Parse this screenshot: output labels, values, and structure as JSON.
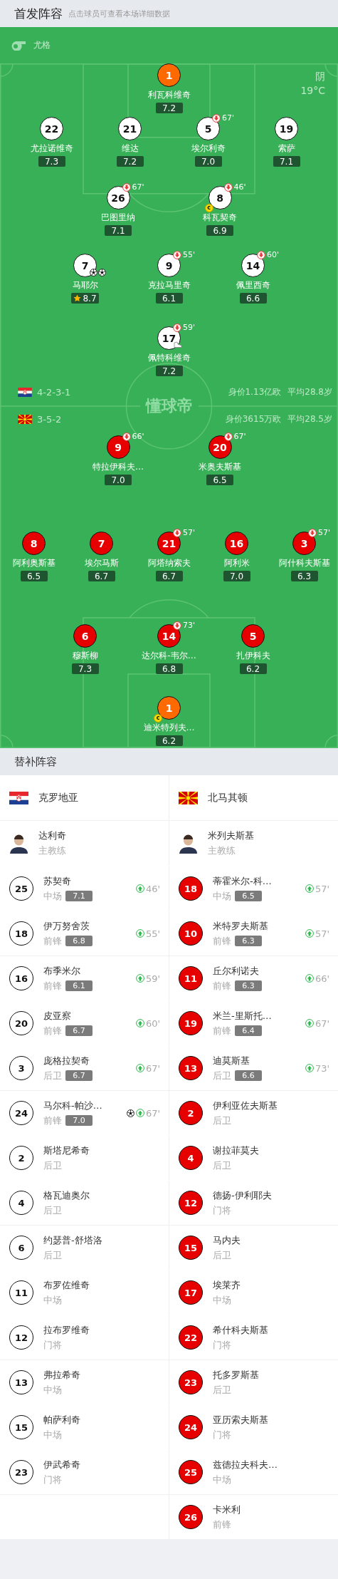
{
  "header": {
    "title": "首发阵容",
    "hint": "点击球员可查看本场详细数据"
  },
  "pitch": {
    "referee": "尤格",
    "weather": "阴",
    "temperature": "19°C",
    "logo": "懂球帝",
    "home": {
      "kind": "croatia",
      "color": "#ffffff",
      "formation": "4-2-3-1",
      "value": "身价1.13亿欧",
      "age": "平均28.8岁",
      "lines": [
        [
          {
            "number": "1",
            "name": "利瓦科维奇",
            "rating": "7.2",
            "kind": "keeper",
            "best": false
          }
        ],
        [
          {
            "number": "22",
            "name": "尤拉诺维奇",
            "rating": "7.3",
            "kind": "field",
            "best": false
          },
          {
            "number": "21",
            "name": "维达",
            "rating": "7.2",
            "kind": "field",
            "best": false
          },
          {
            "number": "5",
            "name": "埃尔利奇",
            "rating": "7.0",
            "kind": "field",
            "best": false,
            "sub_out": "67'"
          },
          {
            "number": "19",
            "name": "索萨",
            "rating": "7.1",
            "kind": "field",
            "best": false
          }
        ],
        [
          {
            "number": "26",
            "name": "巴图里纳",
            "rating": "7.1",
            "kind": "field",
            "best": false,
            "sub_out": "67'"
          },
          {
            "number": "8",
            "name": "科瓦契奇",
            "rating": "6.9",
            "kind": "field",
            "best": false,
            "sub_out": "46'",
            "captain": "c"
          }
        ],
        [
          {
            "number": "7",
            "name": "马耶尔",
            "rating": "8.7",
            "kind": "field",
            "best": true,
            "events": [
              {
                "kind": "goal"
              },
              {
                "kind": "goal"
              }
            ]
          },
          {
            "number": "9",
            "name": "克拉马里奇",
            "rating": "6.1",
            "kind": "field",
            "best": false,
            "sub_out": "55'"
          },
          {
            "number": "14",
            "name": "佩里西奇",
            "rating": "6.6",
            "kind": "field",
            "best": false,
            "sub_out": "60'"
          }
        ],
        [
          {
            "number": "17",
            "name": "佩特科维奇",
            "rating": "7.2",
            "kind": "field",
            "best": false,
            "sub_out": "59'",
            "events": [
              {
                "kind": "assist"
              }
            ]
          }
        ]
      ]
    },
    "away": {
      "kind": "macedonia",
      "color": "#e60000",
      "formation": "3-5-2",
      "value": "身价3615万欧",
      "age": "平均28.5岁",
      "lines": [
        [
          {
            "number": "9",
            "name": "特拉伊科夫…",
            "rating": "7.0",
            "kind": "field",
            "best": false,
            "sub_out": "66'"
          },
          {
            "number": "20",
            "name": "米奥夫斯基",
            "rating": "6.5",
            "kind": "field",
            "best": false,
            "sub_out": "67'"
          }
        ],
        [
          {
            "number": "8",
            "name": "阿利奥斯基",
            "rating": "6.5",
            "kind": "field",
            "best": false
          },
          {
            "number": "7",
            "name": "埃尔马斯",
            "rating": "6.7",
            "kind": "field",
            "best": false
          },
          {
            "number": "21",
            "name": "阿塔纳索夫",
            "rating": "6.7",
            "kind": "field",
            "best": false,
            "sub_out": "57'"
          },
          {
            "number": "16",
            "name": "阿利米",
            "rating": "7.0",
            "kind": "field",
            "best": false
          },
          {
            "number": "3",
            "name": "阿什科夫斯基",
            "rating": "6.3",
            "kind": "field",
            "best": false,
            "sub_out": "57'"
          }
        ],
        [
          {
            "number": "6",
            "name": "穆斯柳",
            "rating": "7.3",
            "kind": "field",
            "best": false
          },
          {
            "number": "14",
            "name": "达尔科-韦尔…",
            "rating": "6.8",
            "kind": "field",
            "best": false,
            "sub_out": "73'"
          },
          {
            "number": "5",
            "name": "扎伊科夫",
            "rating": "6.2",
            "kind": "field",
            "best": false
          }
        ],
        [
          {
            "number": "1",
            "name": "迪米特列夫…",
            "rating": "6.2",
            "kind": "keeper",
            "best": false,
            "captain": "c"
          }
        ]
      ]
    }
  },
  "substitutes": {
    "title": "替补阵容",
    "teams": [
      {
        "name": "克罗地亚",
        "kind": "croatia",
        "color": "#ffffff",
        "coach": {
          "name": "达利奇",
          "role": "主教练"
        },
        "players": [
          {
            "number": "25",
            "name": "苏契奇",
            "position": "中场",
            "rating": "7.1",
            "sub_in": "46'"
          },
          {
            "number": "18",
            "name": "伊万努舍茨",
            "position": "前锋",
            "rating": "6.8",
            "sub_in": "55'"
          },
          {
            "number": "16",
            "name": "布季米尔",
            "position": "前锋",
            "rating": "6.1",
            "sub_in": "59'"
          },
          {
            "number": "20",
            "name": "皮亚察",
            "position": "前锋",
            "rating": "6.7",
            "sub_in": "60'"
          },
          {
            "number": "3",
            "name": "庞格拉契奇",
            "position": "后卫",
            "rating": "6.7",
            "sub_in": "67'"
          },
          {
            "number": "24",
            "name": "马尔科-帕沙…",
            "position": "前锋",
            "rating": "7.0",
            "sub_in": "67'",
            "events": [
              {
                "kind": "goal"
              }
            ]
          },
          {
            "number": "2",
            "name": "斯塔尼希奇",
            "position": "后卫"
          },
          {
            "number": "4",
            "name": "格瓦迪奥尔",
            "position": "后卫"
          },
          {
            "number": "6",
            "name": "约瑟普-舒塔洛",
            "position": "后卫"
          },
          {
            "number": "11",
            "name": "布罗佐维奇",
            "position": "中场"
          },
          {
            "number": "12",
            "name": "拉布罗维奇",
            "position": "门将"
          },
          {
            "number": "13",
            "name": "弗拉希奇",
            "position": "中场"
          },
          {
            "number": "15",
            "name": "帕萨利奇",
            "position": "中场"
          },
          {
            "number": "23",
            "name": "伊武希奇",
            "position": "门将"
          }
        ]
      },
      {
        "name": "北马其顿",
        "kind": "macedonia",
        "color": "#e60000",
        "coach": {
          "name": "米列夫斯基",
          "role": "主教练"
        },
        "players": [
          {
            "number": "18",
            "name": "蒂霍米尔-科…",
            "position": "中场",
            "rating": "6.5",
            "sub_in": "57'"
          },
          {
            "number": "10",
            "name": "米特罗夫斯基",
            "position": "前锋",
            "rating": "6.3",
            "sub_in": "57'"
          },
          {
            "number": "11",
            "name": "丘尔利诺夫",
            "position": "前锋",
            "rating": "6.3",
            "sub_in": "66'"
          },
          {
            "number": "19",
            "name": "米兰-里斯托…",
            "position": "前锋",
            "rating": "6.4",
            "sub_in": "67'"
          },
          {
            "number": "13",
            "name": "迪莫斯基",
            "position": "后卫",
            "rating": "6.6",
            "sub_in": "73'"
          },
          {
            "number": "2",
            "name": "伊利亚佐夫斯基",
            "position": "后卫"
          },
          {
            "number": "4",
            "name": "谢拉菲莫夫",
            "position": "后卫"
          },
          {
            "number": "12",
            "name": "德扬-伊利耶夫",
            "position": "门将"
          },
          {
            "number": "15",
            "name": "马内夫",
            "position": "后卫"
          },
          {
            "number": "17",
            "name": "埃莱齐",
            "position": "中场"
          },
          {
            "number": "22",
            "name": "希什科夫斯基",
            "position": "门将"
          },
          {
            "number": "23",
            "name": "托多罗斯基",
            "position": "后卫"
          },
          {
            "number": "24",
            "name": "亚历索夫斯基",
            "position": "门将"
          },
          {
            "number": "25",
            "name": "兹德拉夫科夫…",
            "position": "中场"
          },
          {
            "number": "26",
            "name": "卡米利",
            "position": "前锋"
          }
        ]
      }
    ]
  }
}
